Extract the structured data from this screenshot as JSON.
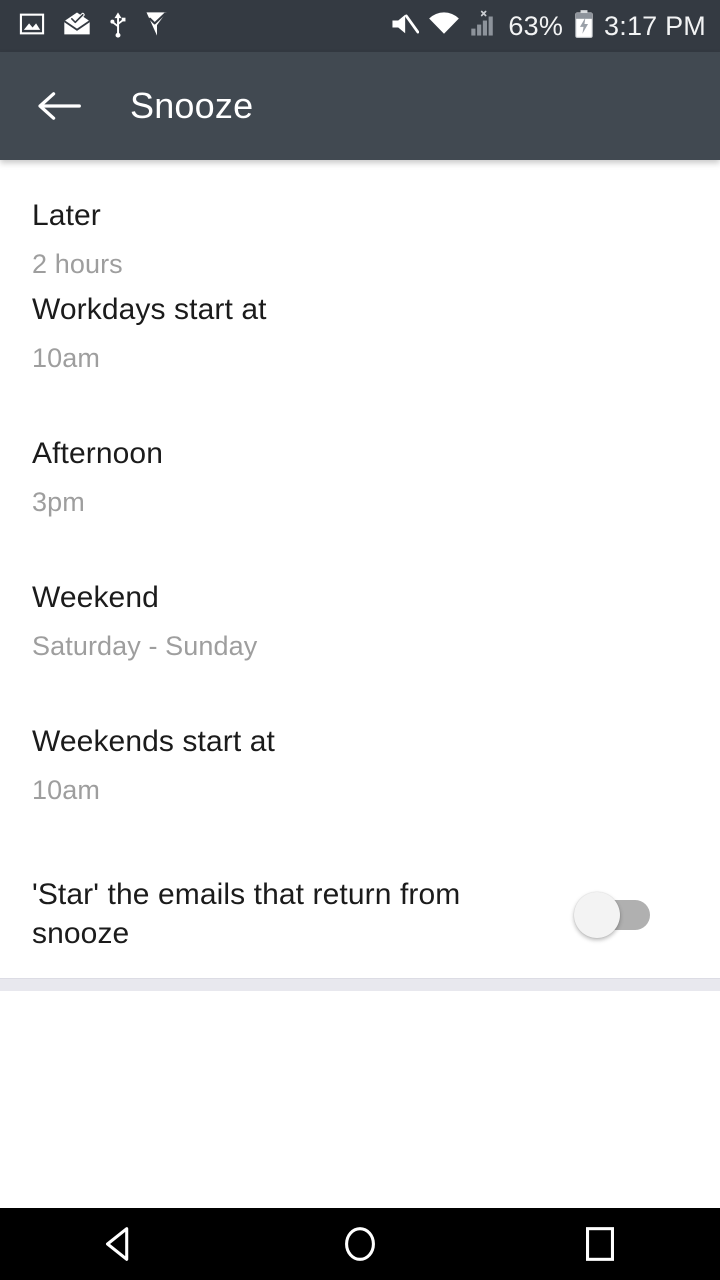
{
  "status_bar": {
    "left_icons": [
      {
        "name": "photo-icon",
        "label": "Screenshot"
      },
      {
        "name": "mail-check-icon",
        "label": "Mail"
      },
      {
        "name": "usb-icon",
        "label": "USB"
      },
      {
        "name": "checkmark-flag-icon",
        "label": "Task"
      }
    ],
    "right_icons": [
      {
        "name": "mute-icon",
        "label": "Silent"
      },
      {
        "name": "wifi-icon",
        "label": "Wi-Fi"
      },
      {
        "name": "cellular-signal-no-service-icon",
        "label": "Signal"
      },
      {
        "name": "battery-charging-icon",
        "label": "Charging"
      }
    ],
    "battery_percent": "63%",
    "clock": "3:17 PM",
    "background_color": "#343a42"
  },
  "app_bar": {
    "back_label": "Back",
    "title": "Snooze",
    "background_color": "#414951",
    "title_color": "#ffffff"
  },
  "settings": {
    "items": [
      {
        "title": "Later",
        "value": "2 hours",
        "type": "value"
      },
      {
        "title": "Workdays start at",
        "value": "10am",
        "type": "value"
      },
      {
        "title": "Afternoon",
        "value": "3pm",
        "type": "value"
      },
      {
        "title": "Weekend",
        "value": "Saturday - Sunday",
        "type": "value"
      },
      {
        "title": "Weekends start at",
        "value": "10am",
        "type": "value"
      },
      {
        "title": "'Star' the emails that return from snooze",
        "value": "",
        "type": "switch",
        "checked": false
      }
    ]
  },
  "nav_bar": {
    "buttons": [
      {
        "name": "back-nav-button",
        "label": "Back"
      },
      {
        "name": "home-nav-button",
        "label": "Home"
      },
      {
        "name": "recents-nav-button",
        "label": "Recents"
      }
    ],
    "background_color": "#000000"
  },
  "colors": {
    "primary_text": "#1b1b1b",
    "secondary_text": "#9e9e9e",
    "divider": "#e8e8ee",
    "switch_track_off": "#b0b0b0",
    "switch_thumb_off": "#f3f3f3"
  }
}
